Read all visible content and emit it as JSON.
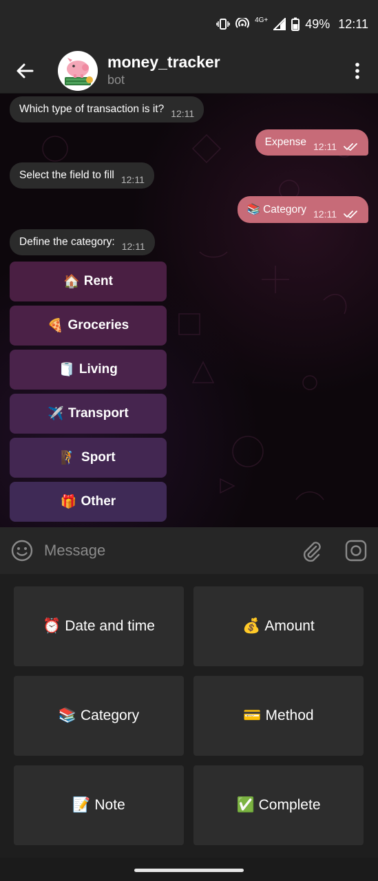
{
  "status": {
    "network": "4G+",
    "battery": "49%",
    "time": "12:11"
  },
  "header": {
    "name": "money_tracker",
    "subtitle": "bot"
  },
  "messages": [
    {
      "text": "Which type of transaction is it?",
      "time": "12:11",
      "dir": "in"
    },
    {
      "text": "Expense",
      "time": "12:11",
      "dir": "out"
    },
    {
      "text": "Select the field to fill",
      "time": "12:11",
      "dir": "in"
    },
    {
      "text": "Category",
      "emoji": "📚",
      "time": "12:11",
      "dir": "out"
    },
    {
      "text": "Define the category:",
      "time": "12:11",
      "dir": "in"
    }
  ],
  "inline_keyboard": [
    {
      "emoji": "🏠",
      "label": "Rent"
    },
    {
      "emoji": "🍕",
      "label": "Groceries"
    },
    {
      "emoji": "🧻",
      "label": "Living"
    },
    {
      "emoji": "✈️",
      "label": "Transport"
    },
    {
      "emoji": "🧗",
      "label": "Sport"
    },
    {
      "emoji": "🎁",
      "label": "Other"
    }
  ],
  "composer": {
    "placeholder": "Message"
  },
  "reply_keyboard": [
    {
      "emoji": "⏰",
      "label": "Date and time"
    },
    {
      "emoji": "💰",
      "label": "Amount"
    },
    {
      "emoji": "📚",
      "label": "Category"
    },
    {
      "emoji": "💳",
      "label": "Method"
    },
    {
      "emoji": "📝",
      "label": "Note"
    },
    {
      "emoji": "✅",
      "label": "Complete"
    }
  ],
  "colors": {
    "outgoing_bubble": "#c76b78",
    "incoming_bubble": "#2b2b2b",
    "header": "#262626"
  }
}
